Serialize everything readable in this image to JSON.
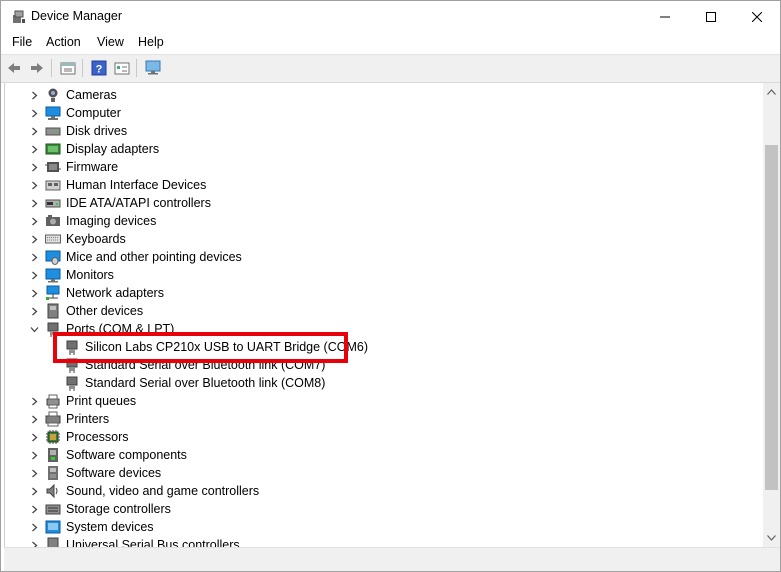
{
  "window": {
    "title": "Device Manager",
    "controls": {
      "minimize": "minimize",
      "maximize": "maximize",
      "close": "close"
    }
  },
  "menu": [
    "File",
    "Action",
    "View",
    "Help"
  ],
  "toolbar": [
    "back-icon",
    "forward-icon",
    "properties-icon",
    "help-icon",
    "details-icon",
    "monitor-scan-icon"
  ],
  "tree": [
    {
      "label": "Cameras",
      "icon": "camera-icon",
      "expanded": false
    },
    {
      "label": "Computer",
      "icon": "computer-icon",
      "expanded": false
    },
    {
      "label": "Disk drives",
      "icon": "disk-icon",
      "expanded": false
    },
    {
      "label": "Display adapters",
      "icon": "display-icon",
      "expanded": false
    },
    {
      "label": "Firmware",
      "icon": "firmware-icon",
      "expanded": false
    },
    {
      "label": "Human Interface Devices",
      "icon": "hid-icon",
      "expanded": false
    },
    {
      "label": "IDE ATA/ATAPI controllers",
      "icon": "ide-icon",
      "expanded": false
    },
    {
      "label": "Imaging devices",
      "icon": "imaging-icon",
      "expanded": false
    },
    {
      "label": "Keyboards",
      "icon": "keyboard-icon",
      "expanded": false
    },
    {
      "label": "Mice and other pointing devices",
      "icon": "mouse-icon",
      "expanded": false
    },
    {
      "label": "Monitors",
      "icon": "monitor-icon",
      "expanded": false
    },
    {
      "label": "Network adapters",
      "icon": "network-icon",
      "expanded": false
    },
    {
      "label": "Other devices",
      "icon": "other-icon",
      "expanded": false
    },
    {
      "label": "Ports (COM & LPT)",
      "icon": "port-icon",
      "expanded": true
    },
    {
      "label": "Silicon Labs CP210x USB to UART Bridge (COM6)",
      "icon": "port-icon",
      "child": true,
      "highlighted": true
    },
    {
      "label": "Standard Serial over Bluetooth link (COM7)",
      "icon": "port-icon",
      "child": true
    },
    {
      "label": "Standard Serial over Bluetooth link (COM8)",
      "icon": "port-icon",
      "child": true
    },
    {
      "label": "Print queues",
      "icon": "print-queue-icon",
      "expanded": false
    },
    {
      "label": "Printers",
      "icon": "printer-icon",
      "expanded": false
    },
    {
      "label": "Processors",
      "icon": "processor-icon",
      "expanded": false
    },
    {
      "label": "Software components",
      "icon": "software-component-icon",
      "expanded": false
    },
    {
      "label": "Software devices",
      "icon": "software-device-icon",
      "expanded": false
    },
    {
      "label": "Sound, video and game controllers",
      "icon": "sound-icon",
      "expanded": false
    },
    {
      "label": "Storage controllers",
      "icon": "storage-icon",
      "expanded": false
    },
    {
      "label": "System devices",
      "icon": "system-icon",
      "expanded": false
    },
    {
      "label": "Universal Serial Bus controllers",
      "icon": "usb-icon",
      "expanded": false
    }
  ],
  "colors": {
    "highlight": "#e8000b",
    "accent": "#0078d7"
  }
}
